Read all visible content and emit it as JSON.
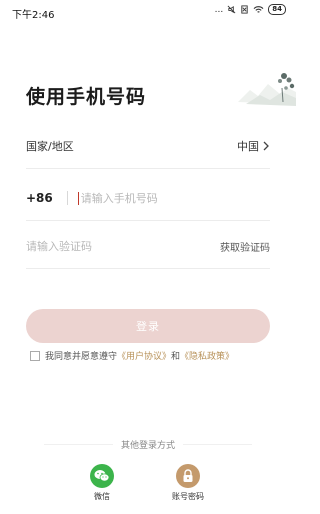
{
  "status_bar": {
    "time": "下午2:46",
    "dots": "...",
    "battery": "84"
  },
  "page": {
    "title": "使用手机号码"
  },
  "region": {
    "label": "国家/地区",
    "value": "中国",
    "chevron": "›"
  },
  "phone": {
    "country_code": "+86",
    "placeholder": "请输入手机号码"
  },
  "code": {
    "placeholder": "请输入验证码",
    "get_code_label": "获取验证码"
  },
  "login": {
    "button_label": "登录"
  },
  "agreement": {
    "prefix": "我同意并愿意遵守",
    "user_agreement": "《用户协议》",
    "and": "和",
    "privacy_policy": "《隐私政策》"
  },
  "other_login": {
    "title": "其他登录方式",
    "options": [
      {
        "label": "微信",
        "icon": "wechat-icon",
        "color": "#3cb44b"
      },
      {
        "label": "账号密码",
        "icon": "lock-icon",
        "color": "#c49a6c"
      }
    ]
  },
  "colors": {
    "login_button": "#ecd3d0",
    "link": "#b8925a"
  }
}
